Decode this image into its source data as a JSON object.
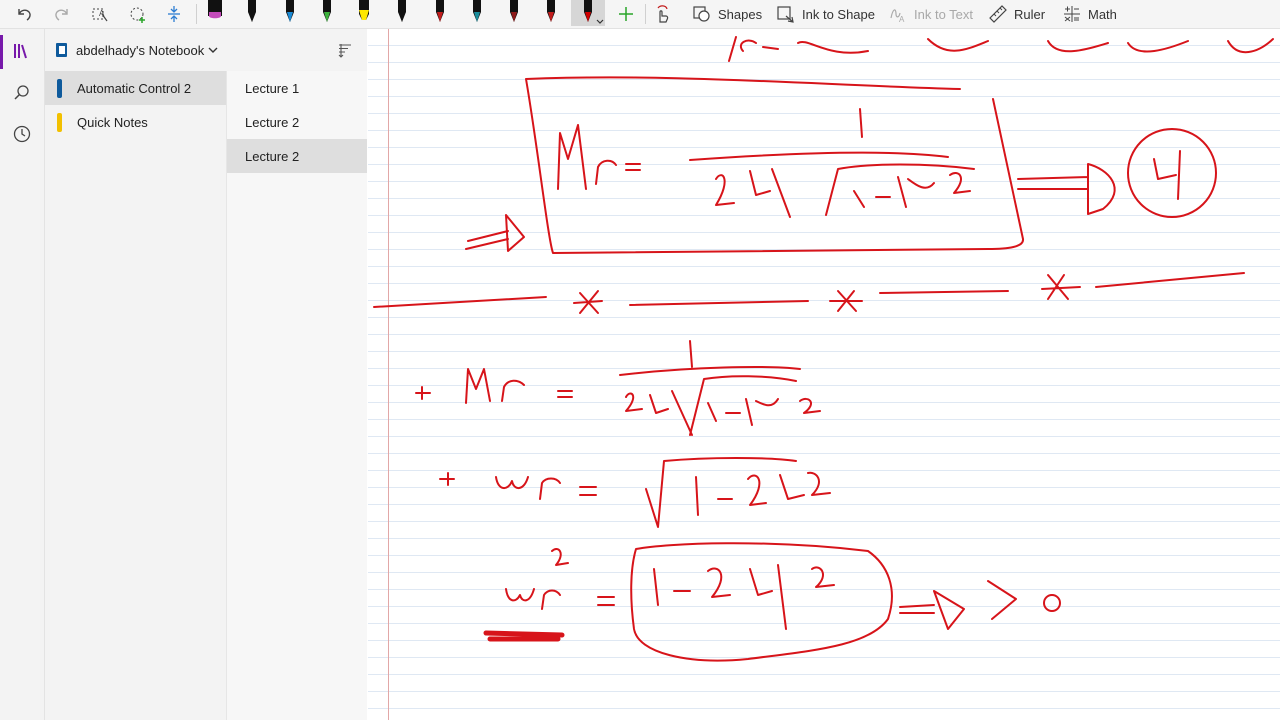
{
  "toolbar": {
    "undo_icon": "undo-icon",
    "redo_icon": "redo-icon",
    "lasso_icon": "lasso-select-icon",
    "eraser_icon": "shape-select-icon",
    "space_icon": "add-space-icon",
    "pens": [
      {
        "name": "pen-pink",
        "color": "#c24bb9"
      },
      {
        "name": "pen-black",
        "color": "#111111"
      },
      {
        "name": "pen-blue",
        "color": "#1b8bd6"
      },
      {
        "name": "pen-green",
        "color": "#3db23d"
      },
      {
        "name": "highlighter-yellow",
        "color": "#ffe800"
      },
      {
        "name": "pen-black-2",
        "color": "#111111"
      },
      {
        "name": "pen-red",
        "color": "#c21d1d"
      },
      {
        "name": "pen-teal",
        "color": "#1a8d9c"
      },
      {
        "name": "pen-darkred",
        "color": "#8e1a1a"
      },
      {
        "name": "pen-red-2",
        "color": "#c21d1d"
      },
      {
        "name": "pen-red-selected",
        "color": "#d10000"
      }
    ],
    "add_pen_icon": "add-pen-icon",
    "touch_draw_icon": "draw-with-touch-icon",
    "shapes_label": "Shapes",
    "ink_to_shape_label": "Ink to Shape",
    "ink_to_text_label": "Ink to Text",
    "ruler_label": "Ruler",
    "math_label": "Math"
  },
  "rail": {
    "notebooks_icon": "notebooks-icon",
    "search_icon": "search-icon",
    "recent_icon": "recent-clock-icon"
  },
  "notebook": {
    "name": "abdelhady's Notebook",
    "sort_icon": "sort-icon"
  },
  "sections": [
    {
      "label": "Automatic Control 2",
      "color": "#0e5a9c",
      "selected": true
    },
    {
      "label": "Quick Notes",
      "color": "#f2c000",
      "selected": false
    }
  ],
  "pages": [
    {
      "label": "Lecture 1",
      "selected": false
    },
    {
      "label": "Lecture 2",
      "selected": false
    },
    {
      "label": "Lecture 2",
      "selected": true
    }
  ],
  "canvas": {
    "ink_color": "#d7141a"
  }
}
